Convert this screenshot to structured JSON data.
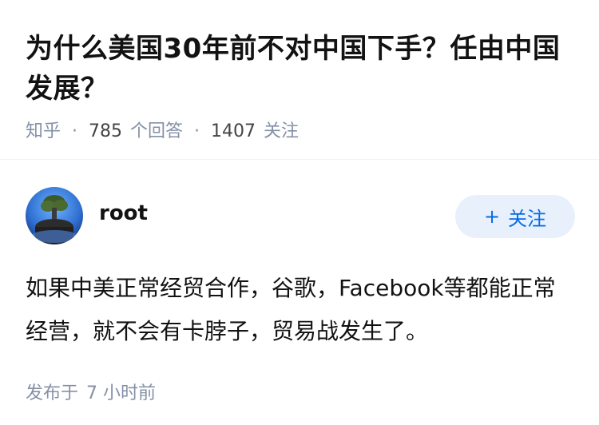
{
  "question": {
    "title": "为什么美国30年前不对中国下手？任由中国发展？",
    "source": "知乎",
    "answer_count": "785",
    "answer_label": "个回答",
    "follower_count": "1407",
    "follower_label": "关注",
    "separator": "·"
  },
  "answer": {
    "author_name": "root",
    "follow_button": {
      "plus": "+",
      "label": "关注"
    },
    "content": "如果中美正常经贸合作，谷歌，Facebook等都能正常经营，就不会有卡脖子，贸易战发生了。",
    "time_prefix": "发布于",
    "time_value": "7 小时前"
  },
  "colors": {
    "accent": "#056de8",
    "accent_bg": "#e8f0fb",
    "meta_text": "#8590a6"
  }
}
